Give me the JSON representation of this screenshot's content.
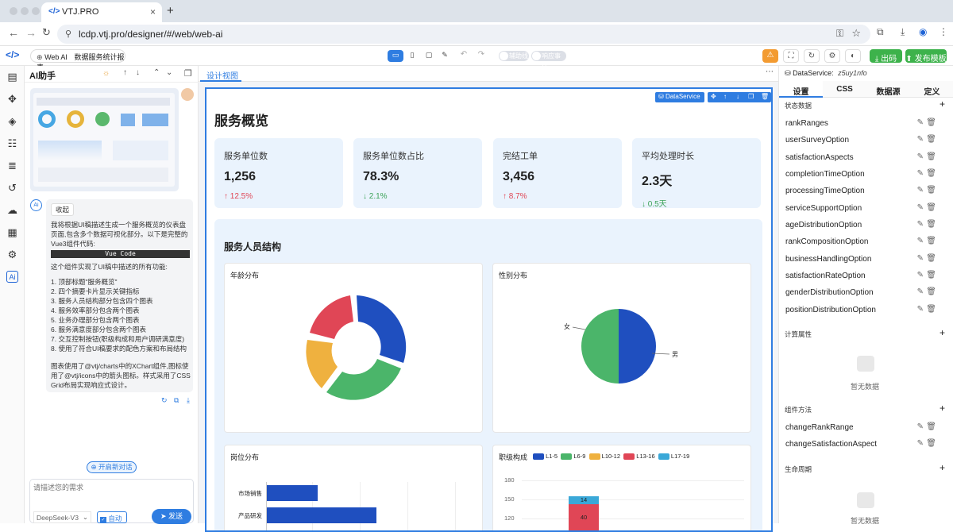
{
  "browser": {
    "tab_title": "VTJ.PRO",
    "url": "lcdp.vtj.pro/designer/#/web/web-ai",
    "new_tab": "+"
  },
  "toolbar": {
    "web_ai": "Web AI",
    "page_name": "数据服务统计报表",
    "toggle1": "辅助线",
    "toggle2": "响应事件",
    "export": "出码",
    "publish": "发布模板"
  },
  "ai": {
    "title": "AI助手",
    "collapse": "收起",
    "intro": "我将根据UI稿描述生成一个服务概览的仪表盘页面,包含多个数据可视化部分。以下是完整的Vue3组件代码:",
    "code_label": "Vue Code",
    "features_title": "这个组件实现了UI稿中描述的所有功能:",
    "features": [
      "顶部标题\"服务概览\"",
      "四个摘要卡片显示关键指标",
      "服务人员结构部分包含四个图表",
      "服务效率部分包含两个图表",
      "业务办理部分包含两个图表",
      "服务满意度部分包含两个图表",
      "交互控制按钮(职级构成和用户调研满意度)",
      "使用了符合UI稿要求的配色方案和布局结构"
    ],
    "footer_text": "图表使用了@vtj/charts中的XChart组件,图标使用了@vtj/icons中的箭头图标。样式采用了CSS Grid布局实现响应式设计。",
    "new_chat": "开启新对话",
    "input_placeholder": "请描述您的需求",
    "model": "DeepSeek-V3",
    "auto": "自动",
    "send": "发送"
  },
  "center": {
    "tab": "设计视图",
    "dataservice_btn": "DataService",
    "page_title": "服务概览",
    "kpis": [
      {
        "title": "服务单位数",
        "value": "1,256",
        "change": "↑ 12.5%",
        "dir": "up"
      },
      {
        "title": "服务单位数占比",
        "value": "78.3%",
        "change": "↓ 2.1%",
        "dir": "down"
      },
      {
        "title": "完结工单",
        "value": "3,456",
        "change": "↑ 8.7%",
        "dir": "up"
      },
      {
        "title": "平均处理时长",
        "value": "2.3天",
        "change": "↓ 0.5天",
        "dir": "down"
      }
    ],
    "section_title": "服务人员结构",
    "age_title": "年龄分布",
    "gender_title": "性别分布",
    "gender_female": "女",
    "gender_male": "男",
    "post_title": "岗位分布",
    "post_items": [
      "市场销售",
      "产品研发"
    ],
    "rank_title": "职级构成",
    "rank_legend": [
      "L1-5",
      "L6-9",
      "L10-12",
      "L13-16",
      "L17-19"
    ],
    "rank_colors": [
      "#1f4fbf",
      "#4bb56a",
      "#efb13f",
      "#e04656",
      "#3aa8d8"
    ],
    "rank_ticks": [
      "180",
      "150",
      "120"
    ],
    "rank_labels": [
      "14",
      "40"
    ]
  },
  "right": {
    "header_label": "DataService:",
    "header_id": "z5uy1nfo",
    "tabs": [
      "设置",
      "CSS",
      "数据源",
      "定义"
    ],
    "state_title": "状态数据",
    "state_items": [
      "rankRanges",
      "userSurveyOption",
      "satisfactionAspects",
      "completionTimeOption",
      "processingTimeOption",
      "serviceSupportOption",
      "ageDistributionOption",
      "rankCompositionOption",
      "businessHandlingOption",
      "satisfactionRateOption",
      "genderDistributionOption",
      "positionDistributionOption"
    ],
    "computed_title": "计算属性",
    "empty": "暂无数据",
    "methods_title": "组件方法",
    "method_items": [
      "changeRankRange",
      "changeSatisfactionAspect"
    ],
    "lifecycle_title": "生命周期",
    "empty2": "暂无数据"
  }
}
